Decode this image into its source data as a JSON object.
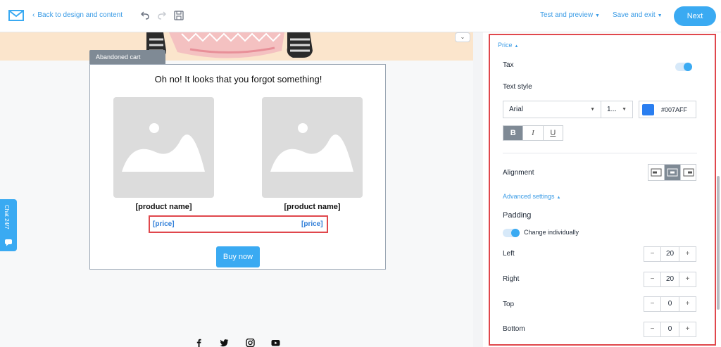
{
  "topbar": {
    "back_label": "Back to design and content",
    "test_preview": "Test and preview",
    "save_exit": "Save and exit",
    "next": "Next"
  },
  "canvas": {
    "block_tag": "Abandoned cart",
    "email_title": "Oh no! It looks that you forgot something!",
    "products": [
      {
        "name": "[product name]",
        "price": "[price]"
      },
      {
        "name": "[product name]",
        "price": "[price]"
      }
    ],
    "buy_button": "Buy now",
    "chat_label": "Chat 24/7"
  },
  "panel": {
    "section": "Price",
    "tax_label": "Tax",
    "text_style_label": "Text style",
    "font": "Arial",
    "font_size": "1...",
    "color_hex": "#007AFF",
    "bold": "B",
    "italic": "I",
    "underline": "U",
    "alignment_label": "Alignment",
    "advanced": "Advanced settings",
    "padding_label": "Padding",
    "change_individually": "Change individually",
    "paddings": [
      {
        "label": "Left",
        "value": "20"
      },
      {
        "label": "Right",
        "value": "20"
      },
      {
        "label": "Top",
        "value": "0"
      },
      {
        "label": "Bottom",
        "value": "0"
      }
    ]
  },
  "colors": {
    "accent": "#3AAAF2",
    "highlight": "#E0474C",
    "swatch": "#2A7EF0"
  }
}
